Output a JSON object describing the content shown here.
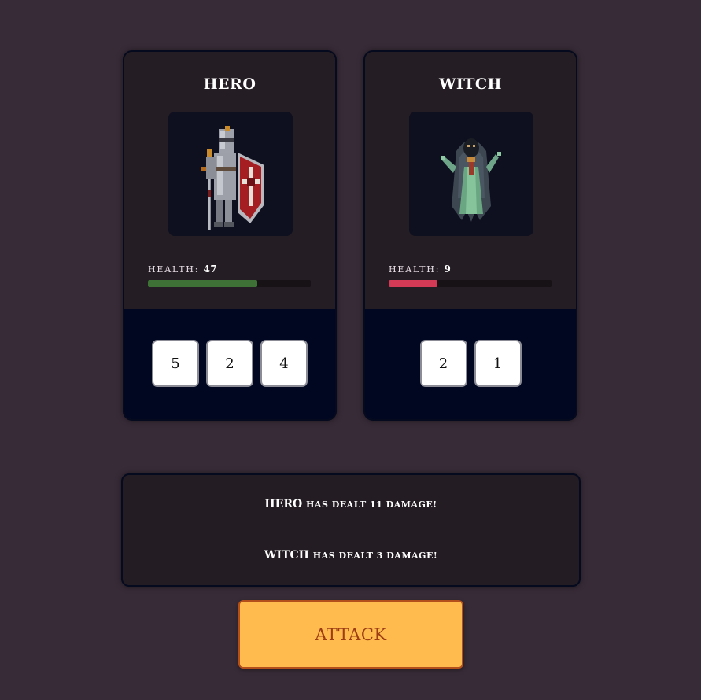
{
  "fighters": [
    {
      "name": "HERO",
      "health_label": "HEALTH:",
      "health": 47,
      "health_fraction": 0.67,
      "health_color": "#3e7136",
      "portrait_icon": "armored-knight-icon",
      "dice": [
        "5",
        "2",
        "4"
      ]
    },
    {
      "name": "WITCH",
      "health_label": "HEALTH:",
      "health": 9,
      "health_fraction": 0.3,
      "health_color": "#d43a56",
      "portrait_icon": "hooded-witch-icon",
      "dice": [
        "2",
        "1"
      ]
    }
  ],
  "log": [
    {
      "actor": "HERO",
      "message": "has dealt 11 damage!"
    },
    {
      "actor": "WITCH",
      "message": "has dealt 3 damage!"
    }
  ],
  "attack_button": {
    "label": "ATTACK",
    "background": "#ffbb4d",
    "text_color": "#9c3d16"
  }
}
